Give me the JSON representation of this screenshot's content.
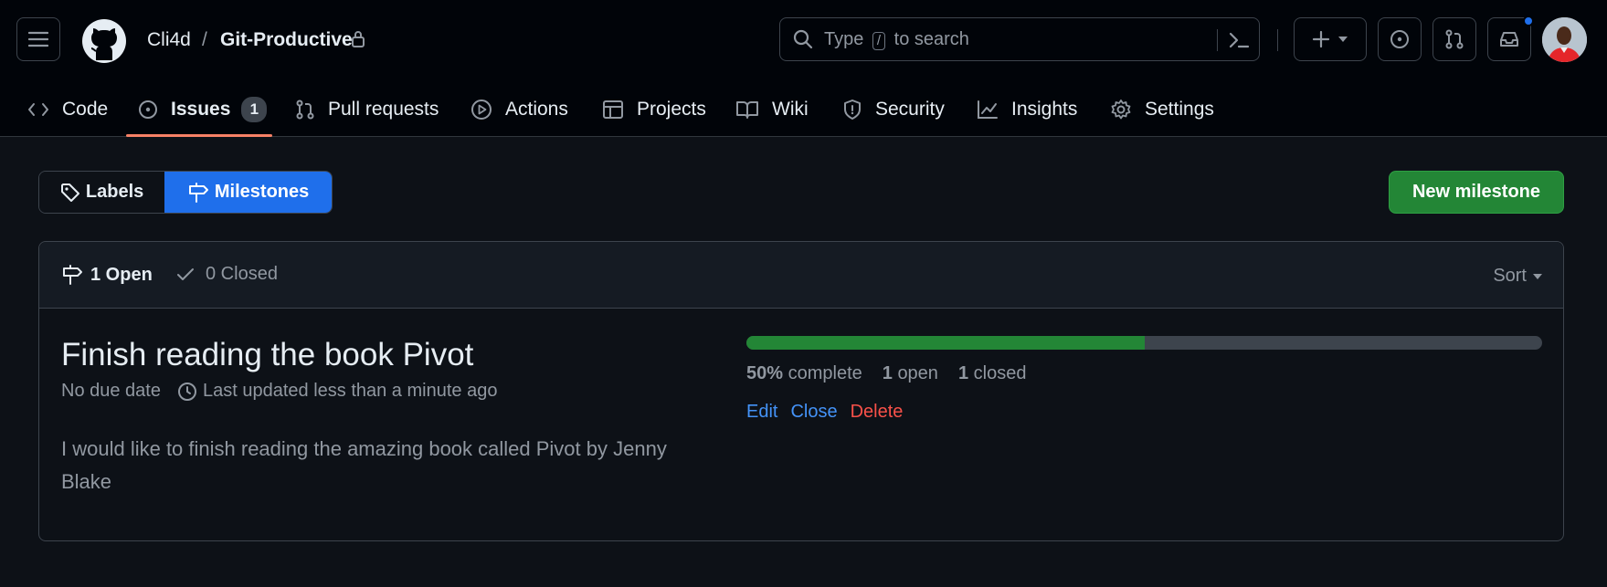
{
  "repo": {
    "owner": "Cli4d",
    "separator": "/",
    "name": "Git-Productive"
  },
  "search": {
    "prefix": "Type",
    "key": "/",
    "suffix": "to search"
  },
  "tabs": [
    {
      "label": "Code",
      "icon": "code-icon"
    },
    {
      "label": "Issues",
      "icon": "issue-opened-icon",
      "count": "1",
      "selected": true
    },
    {
      "label": "Pull requests",
      "icon": "git-pull-request-icon"
    },
    {
      "label": "Actions",
      "icon": "play-icon"
    },
    {
      "label": "Projects",
      "icon": "table-icon"
    },
    {
      "label": "Wiki",
      "icon": "book-icon"
    },
    {
      "label": "Security",
      "icon": "shield-icon"
    },
    {
      "label": "Insights",
      "icon": "graph-icon"
    },
    {
      "label": "Settings",
      "icon": "gear-icon"
    }
  ],
  "subnav": {
    "labels": "Labels",
    "milestones": "Milestones"
  },
  "new_milestone": "New milestone",
  "states": {
    "open": "1 Open",
    "closed": "0 Closed",
    "sort": "Sort"
  },
  "milestone": {
    "title": "Finish reading the book Pivot",
    "due": "No due date",
    "updated": "Last updated less than a minute ago",
    "description": "I would like to finish reading the amazing book called Pivot by Jenny Blake",
    "progress": 0.5,
    "percent": "50%",
    "percent_label": "complete",
    "open_count": "1",
    "open_label": "open",
    "closed_count": "1",
    "closed_label": "closed",
    "actions": {
      "edit": "Edit",
      "close": "Close",
      "delete": "Delete"
    }
  },
  "colors": {
    "accent_blue": "#1f6feb",
    "success": "#238636",
    "danger": "#f85149",
    "link": "#4493f8",
    "tab_underline": "#f78166",
    "notification_dot": "#1f6feb"
  }
}
